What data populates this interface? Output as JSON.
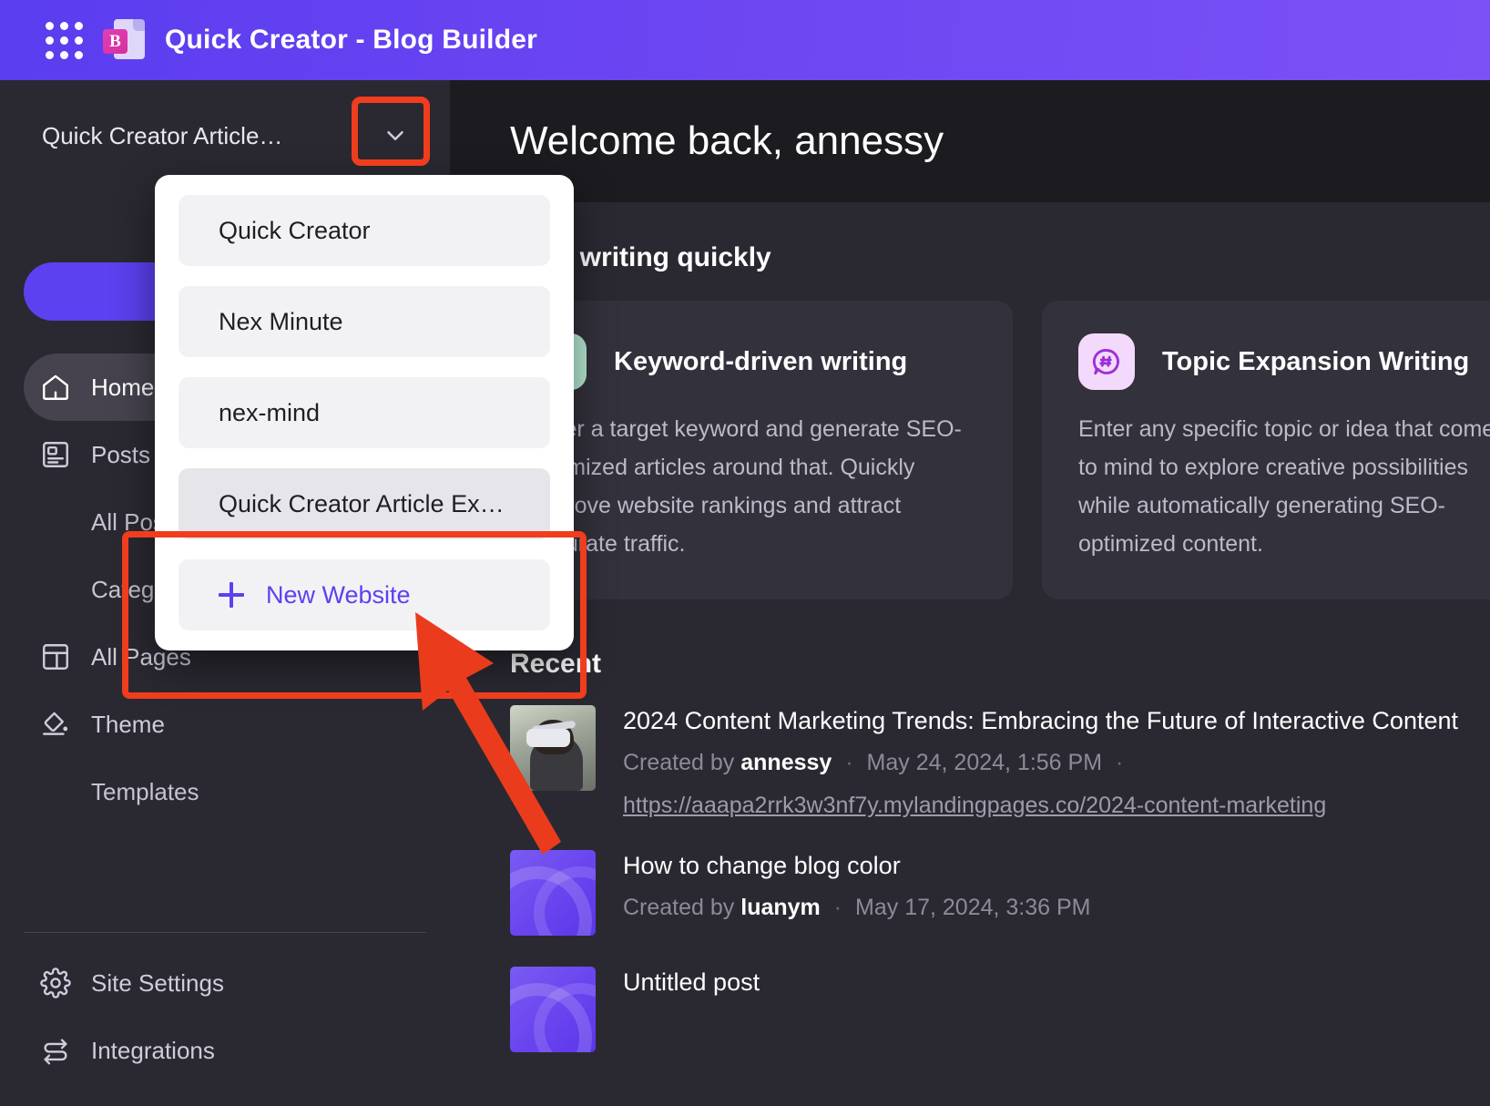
{
  "appbar": {
    "apps_grid_icon": "apps-grid-icon",
    "logo_letter": "B",
    "title": "Quick Creator - Blog Builder",
    "gradient_from": "#5a3def",
    "gradient_to": "#7b52f6"
  },
  "sidebar": {
    "current_site": "Quick Creator Article…",
    "chevron_icon": "chevron-down-icon",
    "new_article_label": "",
    "nav": [
      {
        "label": "Home",
        "icon": "home-icon",
        "active": true
      },
      {
        "label": "Posts",
        "icon": "posts-icon",
        "active": false
      }
    ],
    "posts_sub": [
      {
        "label": "All Posts"
      },
      {
        "label": "Categories"
      }
    ],
    "pages": {
      "label": "All Pages",
      "icon": "layout-icon"
    },
    "theme": {
      "label": "Theme",
      "icon": "paint-bucket-icon"
    },
    "templates": {
      "label": "Templates"
    },
    "bottom": [
      {
        "label": "Site Settings",
        "icon": "gear-icon"
      },
      {
        "label": "Integrations",
        "icon": "integrations-icon"
      }
    ]
  },
  "dropdown": {
    "items": [
      {
        "label": "Quick Creator",
        "selected": false
      },
      {
        "label": "Nex Minute",
        "selected": false
      },
      {
        "label": "nex-mind",
        "selected": false
      },
      {
        "label": "Quick Creator Article Ex…",
        "selected": true
      }
    ],
    "new_website_label": "New Website",
    "new_website_icon": "plus-icon",
    "accent_color": "#5b41f0"
  },
  "main": {
    "welcome": "Welcome back, annessy",
    "start_section_title": "Start writing quickly",
    "cards": [
      {
        "icon": "key-icon",
        "icon_bg": "#b9ecd6",
        "title": "Keyword-driven writing",
        "body": "Enter a target keyword and generate SEO-optimized articles around that. Quickly improve website rankings and attract accurate traffic."
      },
      {
        "icon": "hashtag-bubble-icon",
        "icon_bg": "#f3d9fb",
        "title": "Topic Expansion Writing",
        "body": "Enter any specific topic or idea that comes to mind to explore creative possibilities while automatically generating SEO-optimized content."
      }
    ],
    "recent_title": "Recent",
    "recent": [
      {
        "thumb": "vr-headset-photo",
        "title": "2024 Content Marketing Trends: Embracing the Future of Interactive Content",
        "created_by_label": "Created by",
        "author": "annessy",
        "date": "May 24, 2024, 1:56 PM",
        "url": "https://aaapa2rrk3w3nf7y.mylandingpages.co/2024-content-marketing"
      },
      {
        "thumb": "purple-gradient",
        "title": "How to change blog color",
        "created_by_label": "Created by",
        "author": "luanym",
        "date": "May 17, 2024, 3:36 PM",
        "url": ""
      },
      {
        "thumb": "purple-gradient",
        "title": "Untitled post",
        "created_by_label": "",
        "author": "",
        "date": "",
        "url": ""
      }
    ]
  },
  "annotations": {
    "color": "#f03d1e",
    "chevron_box": "highlight-box-site-switcher-chevron",
    "new_website_box": "highlight-box-new-website",
    "arrow": "pointer-arrow-to-new-website"
  }
}
